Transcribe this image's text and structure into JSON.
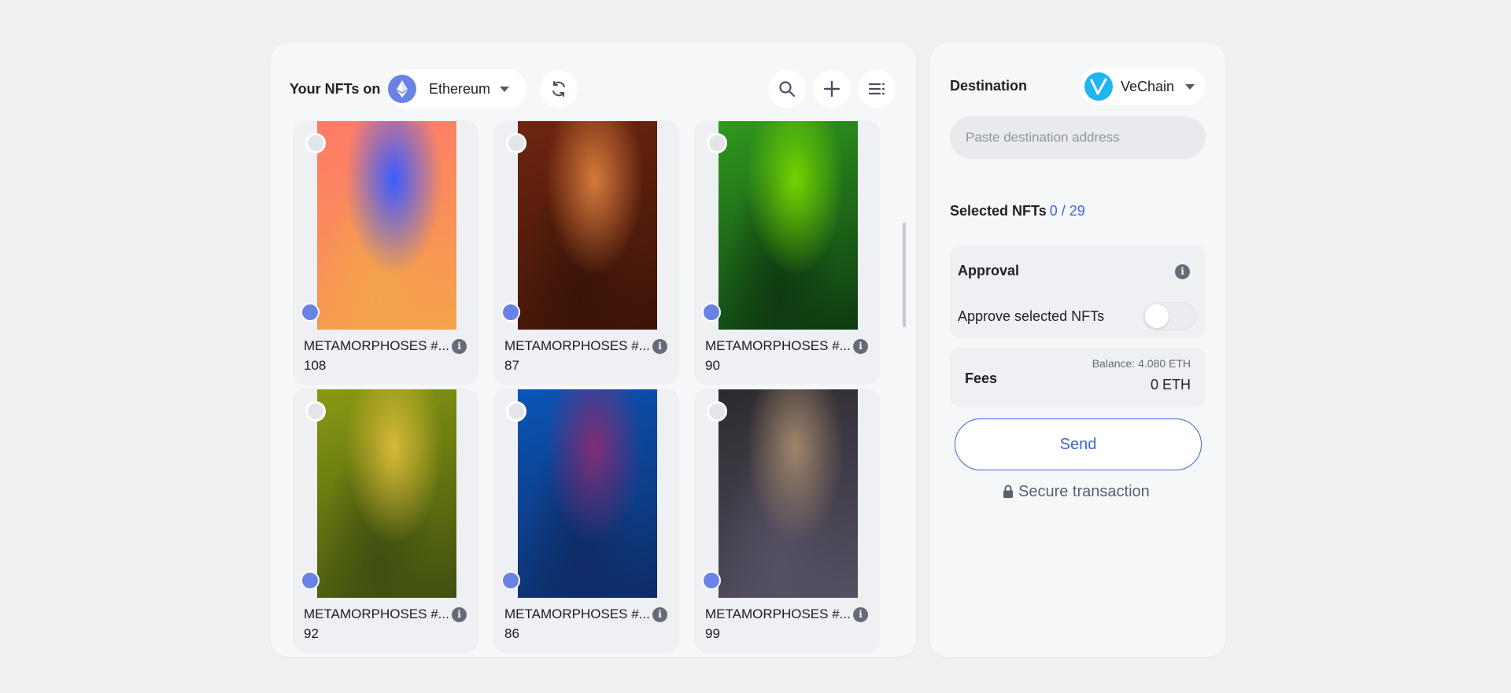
{
  "gallery": {
    "title": "Your NFTs on",
    "chain": "Ethereum",
    "chain_icon": "ethereum-icon",
    "actions": [
      "refresh-icon",
      "search-icon",
      "plus-icon",
      "list-filter-icon"
    ]
  },
  "nfts": [
    {
      "name": "METAMORPHOSES #...",
      "id": "108",
      "palette": [
        "#ff7a6a",
        "#3c5bff",
        "#f4a34a"
      ]
    },
    {
      "name": "METAMORPHOSES #...",
      "id": "87",
      "palette": [
        "#6e2510",
        "#d57a3c",
        "#3b1408"
      ]
    },
    {
      "name": "METAMORPHOSES #...",
      "id": "90",
      "palette": [
        "#2f9a1e",
        "#73d300",
        "#0e3a12"
      ]
    },
    {
      "name": "METAMORPHOSES #...",
      "id": "92",
      "palette": [
        "#8a9a12",
        "#d7b937",
        "#3f4f10"
      ]
    },
    {
      "name": "METAMORPHOSES #...",
      "id": "86",
      "palette": [
        "#0a55b7",
        "#7f2c75",
        "#0f2c66"
      ]
    },
    {
      "name": "METAMORPHOSES #...",
      "id": "99",
      "palette": [
        "#2c2a2e",
        "#a0846a",
        "#565064"
      ]
    }
  ],
  "sidebar": {
    "destination_label": "Destination",
    "destination_chain": "VeChain",
    "address_placeholder": "Paste destination address",
    "selected_label": "Selected NFTs",
    "selected_count": "0 / 29",
    "approval_title": "Approval",
    "approve_label": "Approve selected NFTs",
    "approve_toggle": false,
    "fees_label": "Fees",
    "balance": "Balance: 4.080 ETH",
    "fee_value": "0 ETH",
    "send_label": "Send",
    "secure_label": "Secure transaction"
  },
  "colors": {
    "accent": "#3c66d9",
    "ethereum": "#6a82e6",
    "vechain": "#1fb6ef"
  }
}
